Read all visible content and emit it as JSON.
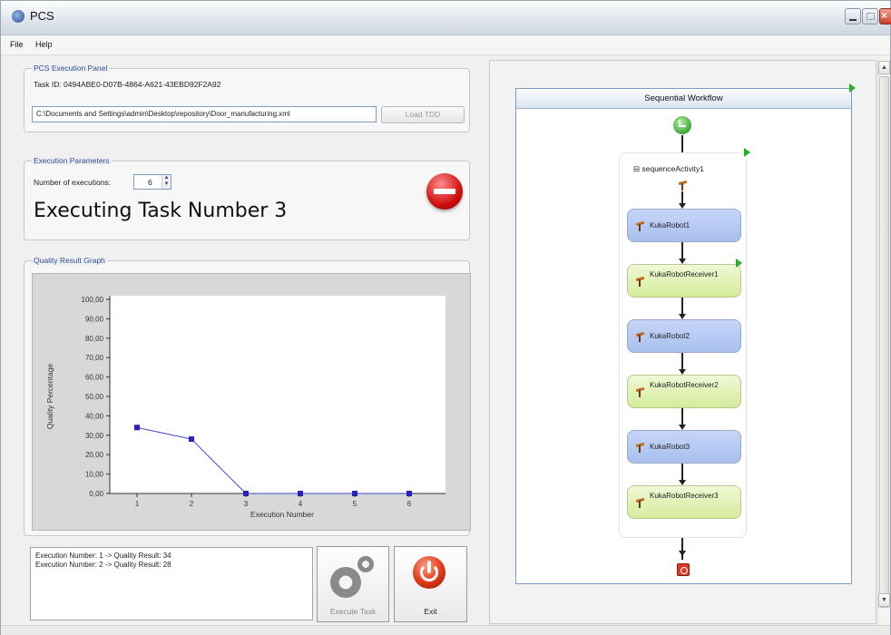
{
  "window": {
    "title": "PCS"
  },
  "menu": {
    "items": [
      "File",
      "Help"
    ]
  },
  "execution_panel": {
    "legend": "PCS Execution Panel",
    "task_id": "Task ID: 0494ABE0-D07B-4864-A621-43EBD92F2A92",
    "path": "C:\\Documents and Settings\\admin\\Desktop\\repository\\Door_manufacturing.xml",
    "load_button": "Load TDD"
  },
  "parameters": {
    "legend": "Execution Parameters",
    "num_label": "Number of executions:",
    "num_value": "6",
    "status_heading": "Executing Task Number 3"
  },
  "graph": {
    "legend": "Quality Result Graph"
  },
  "chart_data": {
    "type": "line",
    "title": "",
    "xlabel": "Execution Number",
    "ylabel": "Quality Percentage",
    "x": [
      1,
      2,
      3,
      4,
      5,
      6
    ],
    "xticks": [
      "1",
      "2",
      "3",
      "4",
      "5",
      "6"
    ],
    "yticks": [
      "0,00",
      "10,00",
      "20,00",
      "30,00",
      "40,00",
      "50,00",
      "60,00",
      "70,00",
      "80,00",
      "90,00",
      "100,00"
    ],
    "ylim": [
      0,
      100
    ],
    "series": [
      {
        "values": [
          34,
          28,
          0,
          0,
          0,
          0
        ],
        "color": "#4a44c8"
      }
    ],
    "grid": false
  },
  "results": {
    "lines": [
      "Execution Number: 1 -> Quality Result: 34",
      "Execution Number: 2 -> Quality Result: 28"
    ]
  },
  "buttons": {
    "execute": "Execute Task",
    "exit": "Exit"
  },
  "workflow": {
    "header": "Sequential Workflow",
    "sequence_title": "sequenceActivity1",
    "nodes": [
      {
        "label": "KukaRobot1",
        "kind": "blue"
      },
      {
        "label": "KukaRobotReceiver1",
        "kind": "green"
      },
      {
        "label": "KukaRobot2",
        "kind": "blue"
      },
      {
        "label": "KukaRobotReceiver2",
        "kind": "green"
      },
      {
        "label": "KukaRobot3",
        "kind": "blue"
      },
      {
        "label": "KukaRobotReceiver3",
        "kind": "green"
      }
    ]
  },
  "colors": {
    "accent_blue": "#2e4e96",
    "stop_red": "#d01010",
    "flag_green": "#27b027"
  }
}
